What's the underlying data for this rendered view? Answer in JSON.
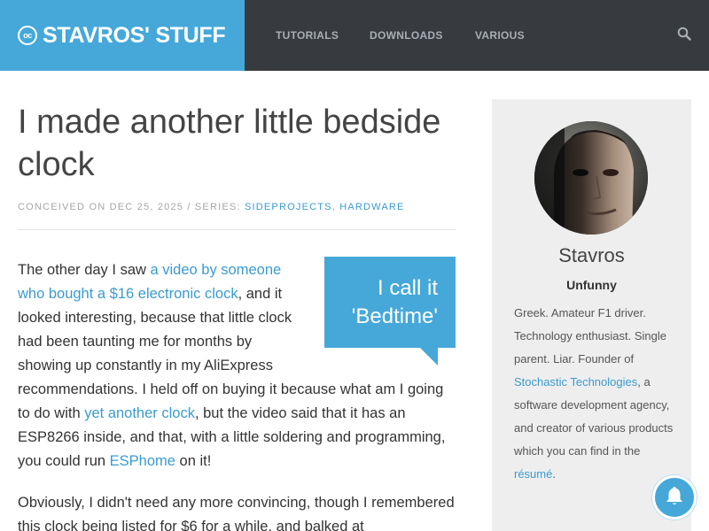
{
  "header": {
    "logo_icon_text": "oc",
    "logo_text": "STAVROS' STUFF",
    "nav": [
      "TUTORIALS",
      "DOWNLOADS",
      "VARIOUS"
    ],
    "search_icon": "search-icon"
  },
  "article": {
    "title": "I made another little bedside clock",
    "meta_prefix": "CONCEIVED ON DEC 25, 2025 / SERIES: ",
    "series": [
      "SIDEPROJECTS",
      "HARDWARE"
    ],
    "series_separator": ", ",
    "callout": "I call it 'Bedtime'",
    "p1": {
      "t1": "The other day I saw ",
      "l1": "a video by someone who bought a $16 electronic clock",
      "t2": ", and it looked interesting, because that little clock had been taunting me for months by showing up constantly in my AliExpress recommendations. I held off on buying it because what am I going to do with ",
      "l2": "yet another clock",
      "t3": ", but the video said that it has an ESP8266 inside, and that, with a little soldering and programming, you could run ",
      "l3": "ESPhome",
      "t4": " on it!"
    },
    "p2": "Obviously, I didn't need any more convincing, though I remembered this clock being listed for $6 for a while, and balked at"
  },
  "sidebar": {
    "name": "Stavros",
    "tagline": "Unfunny",
    "bio": {
      "t1": "Greek. Amateur F1 driver. Technology enthusiast. Single parent. Liar. Founder of ",
      "l1": "Stochastic Technologies",
      "t2": ", a software development agency, and creator of various products which you can find in the ",
      "l2": "résumé",
      "t3": "."
    }
  },
  "notification": {
    "icon": "bell-icon"
  },
  "colors": {
    "accent": "#45a8d9",
    "nav_bg": "#373b40",
    "link": "#3a9bd0",
    "sidebar_bg": "#eeeeee"
  }
}
